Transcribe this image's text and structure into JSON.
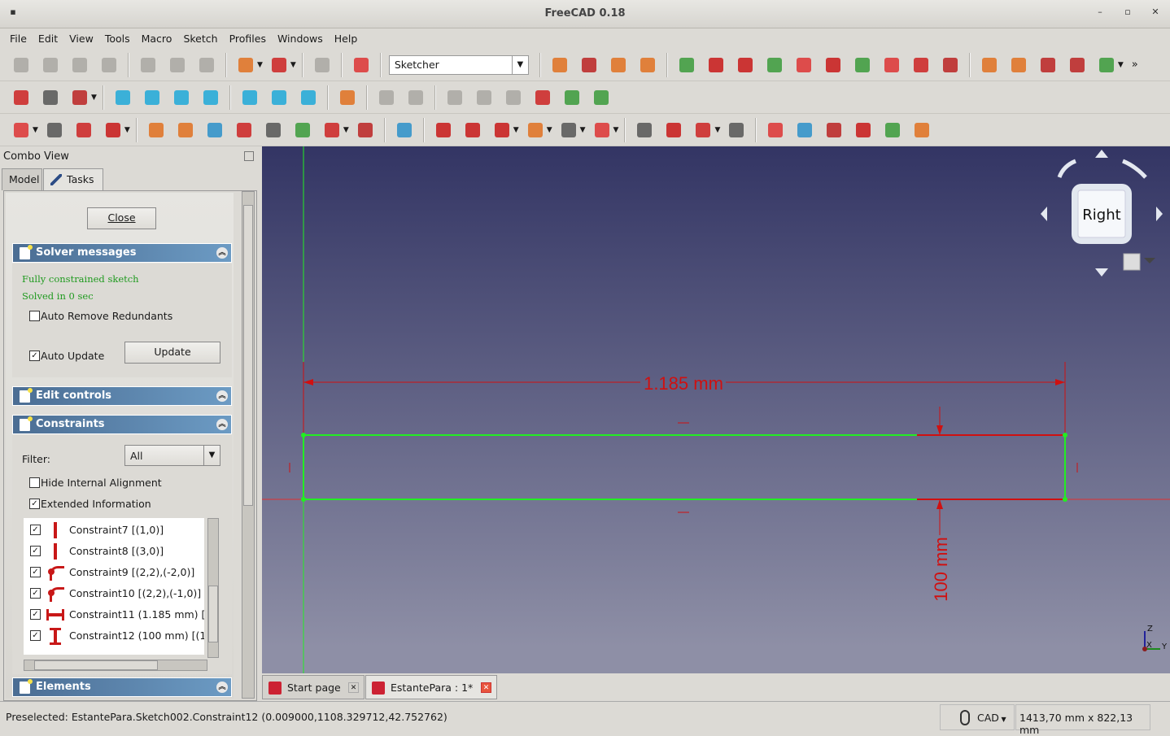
{
  "window": {
    "title": "FreeCAD 0.18",
    "controls": [
      "–",
      "▫",
      "✕"
    ]
  },
  "menu": [
    "File",
    "Edit",
    "View",
    "Tools",
    "Macro",
    "Sketch",
    "Profiles",
    "Windows",
    "Help"
  ],
  "toolbar1": {
    "left": [
      "new",
      "open",
      "save",
      "print",
      "|",
      "cut",
      "copy",
      "paste",
      "|",
      "undo",
      "dd",
      "redo",
      "dd",
      "|",
      "refresh",
      "|",
      "whats-this",
      "|"
    ],
    "workbench": "Sketcher",
    "right": [
      "|",
      "macro-record",
      "macro-stop",
      "macro-edit",
      "macro-run",
      "|",
      "point",
      "fillet-constraint",
      "vertical",
      "horizontal",
      "parallel",
      "perpendicular",
      "tangent",
      "equal",
      "symmetric",
      "block",
      "|",
      "lock",
      "horizontal-distance",
      "vertical-distance",
      "distance",
      "radius",
      "dd"
    ],
    "more": "»"
  },
  "toolbar2": [
    "fit-all",
    "fit-selection",
    "draw-style",
    "dd",
    "|",
    "isometric",
    "front",
    "top",
    "right",
    "|",
    "rear",
    "bottom",
    "left",
    "|",
    "measure",
    "|",
    "part",
    "folder",
    "|",
    "link",
    "import",
    "export",
    "sketch-on",
    "view-section",
    "view-sketch"
  ],
  "toolbar3": [
    "new-sketch",
    "dd",
    "leave-sketch",
    "grid",
    "snap",
    "dd",
    "|",
    "mirror",
    "clone",
    "validate",
    "merge",
    "close-shape",
    "connect",
    "select-constraints",
    "dd",
    "array",
    "|",
    "external",
    "|",
    "point",
    "line",
    "arc",
    "dd",
    "circle",
    "dd",
    "conic",
    "dd",
    "bspline",
    "dd",
    "|",
    "polyline",
    "rectangle",
    "polygon",
    "dd",
    "slot",
    "|",
    "fillet",
    "trim",
    "extend",
    "external-geometry",
    "carbon-copy",
    "construction"
  ],
  "combo": {
    "title": "Combo View",
    "tabs": [
      "Model",
      "Tasks"
    ]
  },
  "tasks": {
    "close": "Close",
    "solver": {
      "title": "Solver messages",
      "msg1": "Fully constrained sketch",
      "msg2": "Solved in 0 sec",
      "auto_remove": "Auto Remove Redundants",
      "auto_remove_checked": false,
      "auto_update": "Auto Update",
      "auto_update_checked": true,
      "update": "Update"
    },
    "edit_controls": {
      "title": "Edit controls"
    },
    "constraints": {
      "title": "Constraints",
      "filter_label": "Filter:",
      "filter_value": "All",
      "hide_internal": "Hide Internal Alignment",
      "hide_internal_checked": false,
      "extended": "Extended Information",
      "extended_checked": true,
      "items": [
        {
          "label": "Constraint7 [(1,0)]",
          "icon": "vertical-constraint-icon"
        },
        {
          "label": "Constraint8 [(3,0)]",
          "icon": "vertical-constraint-icon"
        },
        {
          "label": "Constraint9 [(2,2),(-2,0)]",
          "icon": "tangent-constraint-icon"
        },
        {
          "label": "Constraint10 [(2,2),(-1,0)]",
          "icon": "tangent-constraint-icon"
        },
        {
          "label": "Constraint11 (1.185 mm) [(",
          "icon": "horizontal-distance-icon"
        },
        {
          "label": "Constraint12 (100 mm) [(1,",
          "icon": "vertical-distance-icon"
        }
      ]
    },
    "elements": {
      "title": "Elements"
    }
  },
  "viewport": {
    "dim_horizontal": "1.185 mm",
    "dim_vertical": "100 mm",
    "navcube_face": "Right",
    "axis": {
      "z": "Z",
      "x": "X",
      "y": "Y"
    },
    "colors": {
      "sketch": "#22ee22",
      "constraint": "#d01010",
      "bg_top": "#333564",
      "bg_bottom": "#8e8fa6"
    }
  },
  "doctabs": [
    {
      "label": "Start page"
    },
    {
      "label": "EstantePara : 1*"
    }
  ],
  "status": {
    "message": "Preselected: EstantePara.Sketch002.Constraint12 (0.009000,1108.329712,42.752762)",
    "nav_style": "CAD",
    "dimensions": "1413,70 mm x 822,13 mm"
  }
}
